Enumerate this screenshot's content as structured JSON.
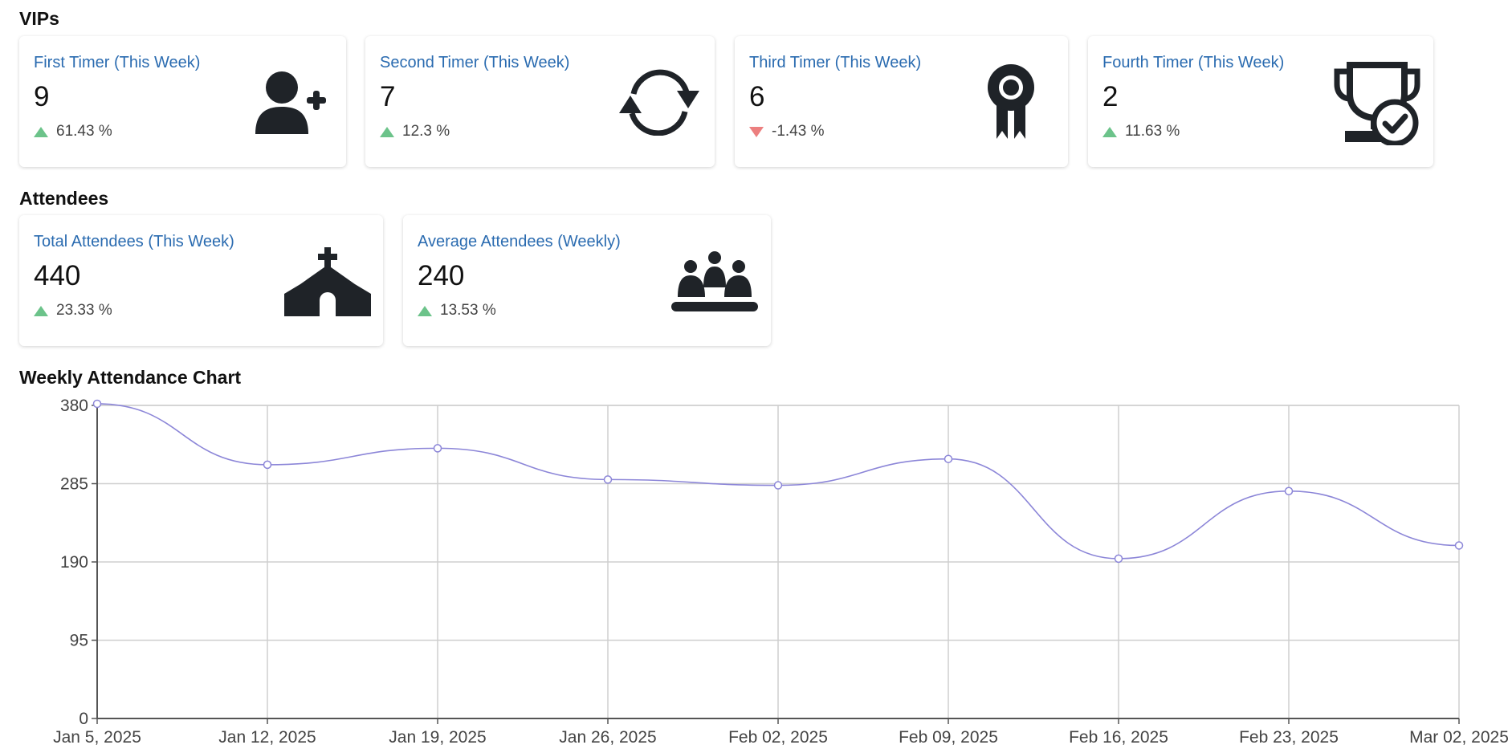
{
  "sections": {
    "vips": "VIPs",
    "attendees": "Attendees",
    "chart": "Weekly Attendance Chart"
  },
  "vip_cards": [
    {
      "title": "First Timer (This Week)",
      "value": "9",
      "delta": "61.43 %",
      "trend": "up",
      "icon": "user-plus-icon"
    },
    {
      "title": "Second Timer (This Week)",
      "value": "7",
      "delta": "12.3 %",
      "trend": "up",
      "icon": "refresh-icon"
    },
    {
      "title": "Third Timer (This Week)",
      "value": "6",
      "delta": "-1.43 %",
      "trend": "down",
      "icon": "award-ribbon-icon"
    },
    {
      "title": "Fourth Timer (This Week)",
      "value": "2",
      "delta": "11.63 %",
      "trend": "up",
      "icon": "trophy-check-icon"
    }
  ],
  "attendee_cards": [
    {
      "title": "Total Attendees (This Week)",
      "value": "440",
      "delta": "23.33 %",
      "trend": "up",
      "icon": "church-icon"
    },
    {
      "title": "Average Attendees (Weekly)",
      "value": "240",
      "delta": "13.53 %",
      "trend": "up",
      "icon": "people-group-icon"
    }
  ],
  "colors": {
    "link": "#2a6bb0",
    "up": "#6cc38a",
    "down": "#ec7f7f",
    "line": "#8c86d8"
  },
  "chart_data": {
    "type": "line",
    "title": "Weekly Attendance Chart",
    "categories": [
      "Jan 5, 2025",
      "Jan 12, 2025",
      "Jan 19, 2025",
      "Jan 26, 2025",
      "Feb 02, 2025",
      "Feb 09, 2025",
      "Feb 16, 2025",
      "Feb 23, 2025",
      "Mar 02, 2025"
    ],
    "values": [
      382,
      308,
      328,
      290,
      283,
      315,
      194,
      276,
      210
    ],
    "ylim": [
      0,
      380
    ],
    "yticks": [
      0,
      95,
      190,
      285,
      380
    ],
    "grid": true,
    "smooth": true
  }
}
